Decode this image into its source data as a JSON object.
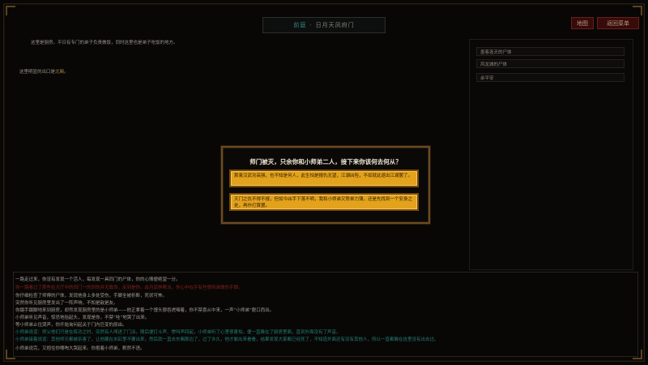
{
  "location": {
    "area": "前庭",
    "separator": "·",
    "name": "日月天凤府门"
  },
  "top_buttons": {
    "map": "地图",
    "menu": "返回菜单"
  },
  "description": {
    "line1": "这里是厨房。平日有专门的弟子负责做饭，同时这里也是弟子吃饭的地方。",
    "line2_prefix": "这里明显的出口是",
    "line2_exit": "北厢",
    "line2_suffix": "。"
  },
  "right_panel": {
    "items": [
      {
        "label": "墨客连天的尸体"
      },
      {
        "label": "风龙城的尸体"
      },
      {
        "label": "余平安"
      }
    ]
  },
  "dialog": {
    "question": "师门被灭，只余你和小师弟二人，接下来你该何去何从？",
    "choices": [
      {
        "text": "那袁汉武功高强，也不知是何人，此生怕是报仇无望，江湖凶险，不如就此退出江湖罢了。"
      },
      {
        "text": "灭门之仇不得不报，但如今凶手下落不明，我和小师弟又势单力薄，还是先找到一个安身之处，再作打算罢。"
      }
    ]
  },
  "log": {
    "lines": [
      {
        "text": "一路走过来，你没有发现一个活人，每发现一具同门的尸体，你的心情便绝望一分。",
        "color": "#d8d0c0"
      },
      {
        "text": "你一路看过了那些在大厅中的同门一的剑伤并无致命，反到是你。血月武林帮派，你心中似乎有些想到谁做的手脚。",
        "color": "#b02a22"
      },
      {
        "text": "你仔细检查了师傅的尸体，发现他身上多处受伤，手脚全被折断，死状可怖。",
        "color": "#d8d0c0"
      },
      {
        "text": "突然你听见厨房里发出了一阵声响，不知是敌是友。",
        "color": "#d8d0c0"
      },
      {
        "text": "你蹑手蹑脚地来到厨房，却然发现厨房里的是小师弟——他正拿着一个馒头狼吞虎咽着，你不禁喜从中来，一声“小师弟”脱口而出。",
        "color": "#d8d0c0"
      },
      {
        "text": "小师弟听见声音，惊恐地抬起头，发现是你，不禁“哇”地哭了出来。",
        "color": "#d8d0c0"
      },
      {
        "text": "等小师弟止住哭声，你开始询问起关于门内巨变的原由。",
        "color": "#d8d0c0"
      },
      {
        "text": "小师弟说道：师父他们只是在练功之时，突然有人闯进了门派，随后便打斗声、惨叫声四起，小师弟听了心里很害怕，便一直躲在了厨房里面，直到外面没有了声音。",
        "color": "#2fa89a"
      },
      {
        "text": "小师弟接着说道：其他师兄都被杀害了，让他藏在米缸里不要出来，然后就一直去东厢那边了，过了许久，他才敢出来看看，结果发现大家都已经死了，不知道外面还有没有其他人，所以一直都躲在这里没有出去过。",
        "color": "#2fa89a"
      },
      {
        "text": "小师弟说完，又抱住你嚎啕大哭起来。你抱着小师弟，默然不语。",
        "color": "#d8d0c0"
      }
    ]
  }
}
